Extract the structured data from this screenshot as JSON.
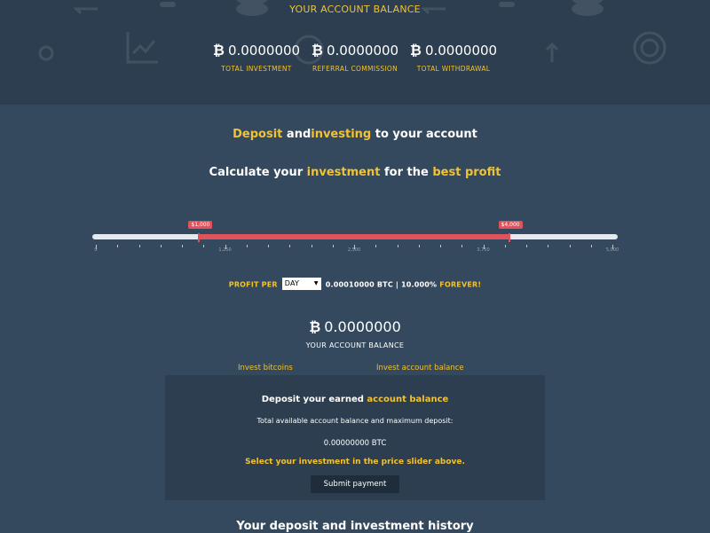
{
  "header": {
    "title": "YOUR ACCOUNT BALANCE",
    "currency_symbol": "₿",
    "stats": [
      {
        "value": "0.0000000",
        "label": "TOTAL INVESTMENT"
      },
      {
        "value": "0.0000000",
        "label": "REFERRAL COMMISSION"
      },
      {
        "value": "0.0000000",
        "label": "TOTAL WITHDRAWAL"
      }
    ],
    "background_icons": [
      "exchange-icon",
      "coin-stack-icon",
      "chart-icon",
      "dollar-coin-icon",
      "arrows-icon"
    ]
  },
  "deposit_heading": {
    "part1": "Deposit",
    "part2": " and",
    "part3": "investing",
    "part4": " to your account"
  },
  "calc_heading": {
    "part1": "Calculate your ",
    "part2": "investment",
    "part3": " for the ",
    "part4": "best profit"
  },
  "slider": {
    "min": 0,
    "max": 5000,
    "low_value": 1000,
    "high_value": 4000,
    "low_label": "$1,000",
    "high_label": "$4,000",
    "tick_labels": [
      "0",
      "1,250",
      "2,500",
      "3,750",
      "5,000"
    ]
  },
  "profit": {
    "label": "PROFIT PER",
    "period": "DAY",
    "amount": "0.00010000 BTC | 10.000%",
    "forever": "FOREVER!"
  },
  "account_balance": {
    "symbol": "₿",
    "value": "0.0000000",
    "label": "YOUR ACCOUNT BALANCE"
  },
  "tabs": {
    "invest_bitcoins": "Invest bitcoins",
    "invest_balance": "Invest account balance"
  },
  "deposit_panel": {
    "title_part1": "Deposit your earned ",
    "title_part2": "account balance",
    "info": "Total available account balance and maximum deposit:",
    "amount": "0.00000000 BTC",
    "instruction": "Select your investment in the price slider above.",
    "submit_label": "Submit payment"
  },
  "history_heading": "Your deposit and investment history",
  "colors": {
    "accent": "#f1c232",
    "slider_range": "#e0535d",
    "background": "#34495e",
    "header_bg": "#2c3e50"
  }
}
